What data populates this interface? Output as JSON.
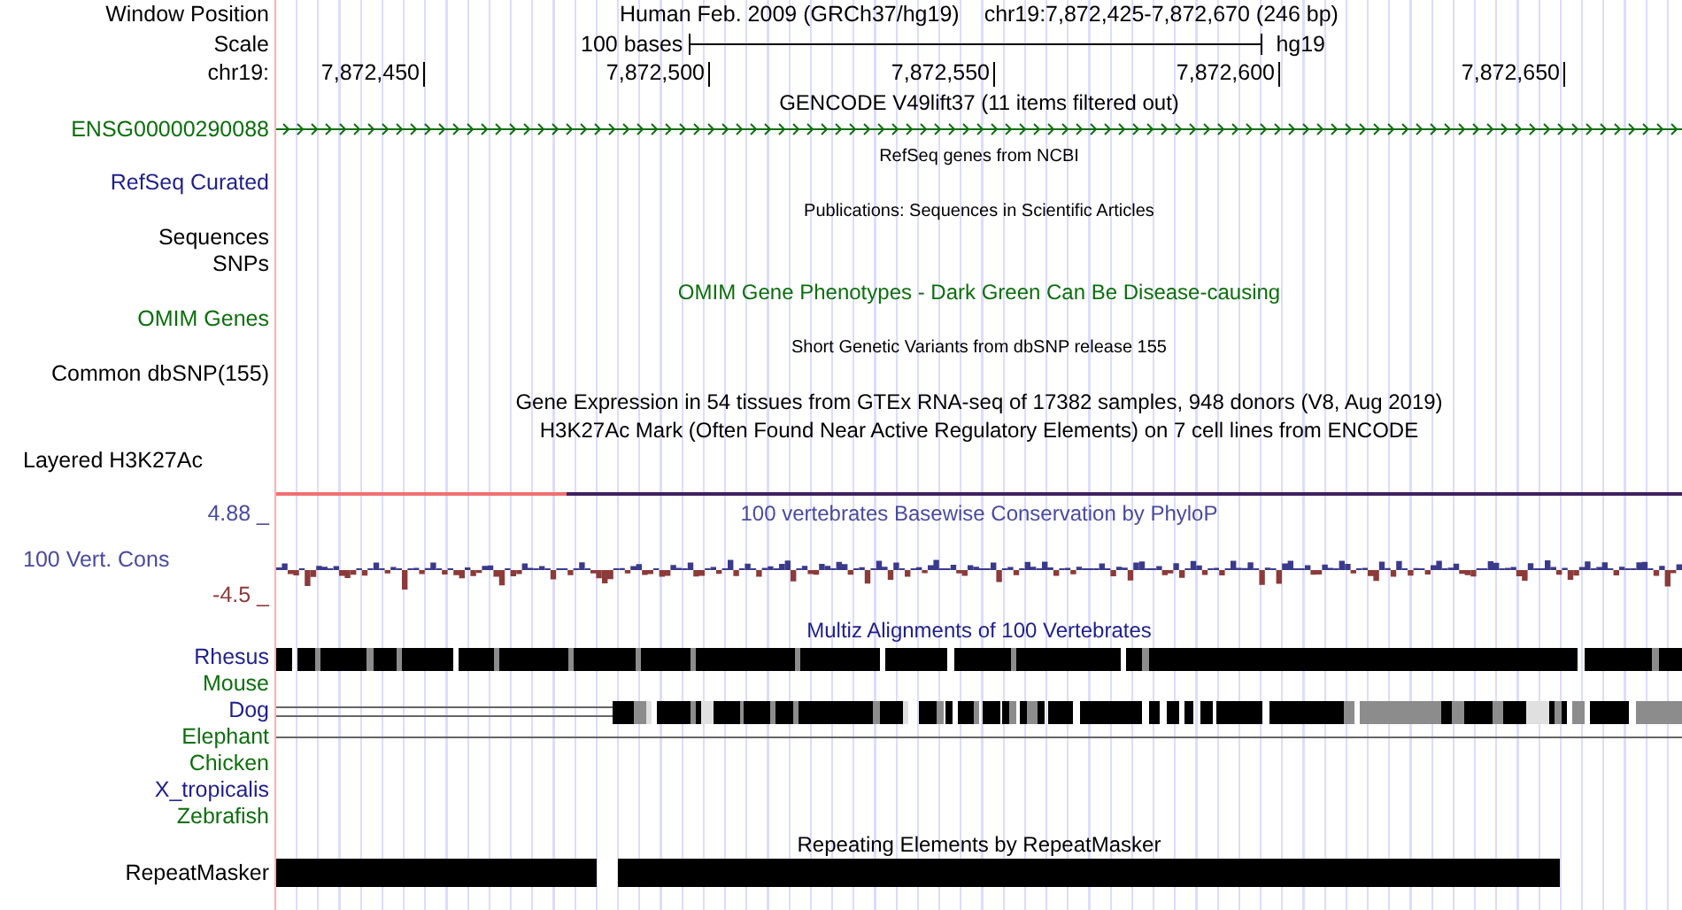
{
  "header": {
    "position_label": "Window Position",
    "assembly": "Human Feb. 2009 (GRCh37/hg19)",
    "position": "chr19:7,872,425-7,872,670 (246 bp)",
    "scale_label": "Scale",
    "scale_text": "100 bases",
    "scale_db": "hg19",
    "chrom_label": "chr19:",
    "ruler_ticks": [
      "7,872,450",
      "7,872,500",
      "7,872,550",
      "7,872,600",
      "7,872,650"
    ]
  },
  "tracks": [
    {
      "kind": "gene",
      "title": {
        "text": "GENCODE V49lift37 (11 items filtered out)",
        "small": false,
        "color": "#000000"
      },
      "labels": [
        {
          "text": "ENSG00000290088",
          "color": "#0c6e0c"
        }
      ]
    },
    {
      "kind": "empty",
      "title": {
        "text": "RefSeq genes from NCBI",
        "small": true,
        "color": "#000000"
      },
      "labels": [
        {
          "text": "RefSeq Curated",
          "color": "#1f1f8c"
        }
      ]
    },
    {
      "kind": "empty",
      "title": {
        "text": "Publications: Sequences in Scientific Articles",
        "small": true,
        "color": "#000000"
      },
      "labels": [
        {
          "text": "Sequences",
          "color": "#000000"
        },
        {
          "text": "SNPs",
          "color": "#000000"
        }
      ]
    },
    {
      "kind": "empty",
      "title": {
        "text": "OMIM Gene Phenotypes - Dark Green Can Be Disease-causing",
        "small": false,
        "color": "#0c6e0c"
      },
      "labels": [
        {
          "text": "OMIM Genes",
          "color": "#0c6e0c"
        }
      ]
    },
    {
      "kind": "empty",
      "title": {
        "text": "Short Genetic Variants from dbSNP release 155",
        "small": true,
        "color": "#000000"
      },
      "labels": [
        {
          "text": "Common dbSNP(155)",
          "color": "#000000"
        }
      ]
    },
    {
      "kind": "empty",
      "title": {
        "text": "Gene Expression in 54 tissues from GTEx RNA-seq of 17382 samples, 948 donors (V8, Aug 2019)",
        "small": false,
        "color": "#000000"
      }
    },
    {
      "kind": "signal",
      "title": {
        "text": "H3K27Ac Mark (Often Found Near Active Regulatory Elements) on 7 cell lines from ENCODE",
        "small": false,
        "color": "#000000"
      },
      "labels": [
        {
          "text": "Layered H3K27Ac",
          "color": "#000000"
        }
      ]
    },
    {
      "kind": "wiggle",
      "title": {
        "text": "100 vertebrates Basewise Conservation by PhyloP",
        "small": false,
        "color": "#4a4aa0"
      },
      "upper": "4.88 _",
      "lower": "-4.5 _",
      "labels": [
        {
          "text": "100 Vert. Cons",
          "color": "#4a4aa0"
        }
      ]
    },
    {
      "kind": "multiz",
      "title": {
        "text": "Multiz Alignments of 100 Vertebrates",
        "small": false,
        "color": "#1f1f8c"
      },
      "labels": [
        {
          "text": "Rhesus",
          "color": "#1f1f8c",
          "kind": "blocks"
        },
        {
          "text": "Mouse",
          "color": "#0c6e0c",
          "kind": "none"
        },
        {
          "text": "Dog",
          "color": "#1f1f8c",
          "kind": "partial"
        },
        {
          "text": "Elephant",
          "color": "#0c6e0c",
          "kind": "line"
        },
        {
          "text": "Chicken",
          "color": "#0c6e0c",
          "kind": "none"
        },
        {
          "text": "X_tropicalis",
          "color": "#1f1f8c",
          "kind": "none"
        },
        {
          "text": "Zebrafish",
          "color": "#0c6e0c",
          "kind": "none"
        }
      ]
    },
    {
      "kind": "repeat",
      "title": {
        "text": "Repeating Elements by RepeatMasker",
        "small": false,
        "color": "#000000"
      },
      "labels": [
        {
          "text": "RepeatMasker",
          "color": "#000000"
        }
      ]
    }
  ]
}
